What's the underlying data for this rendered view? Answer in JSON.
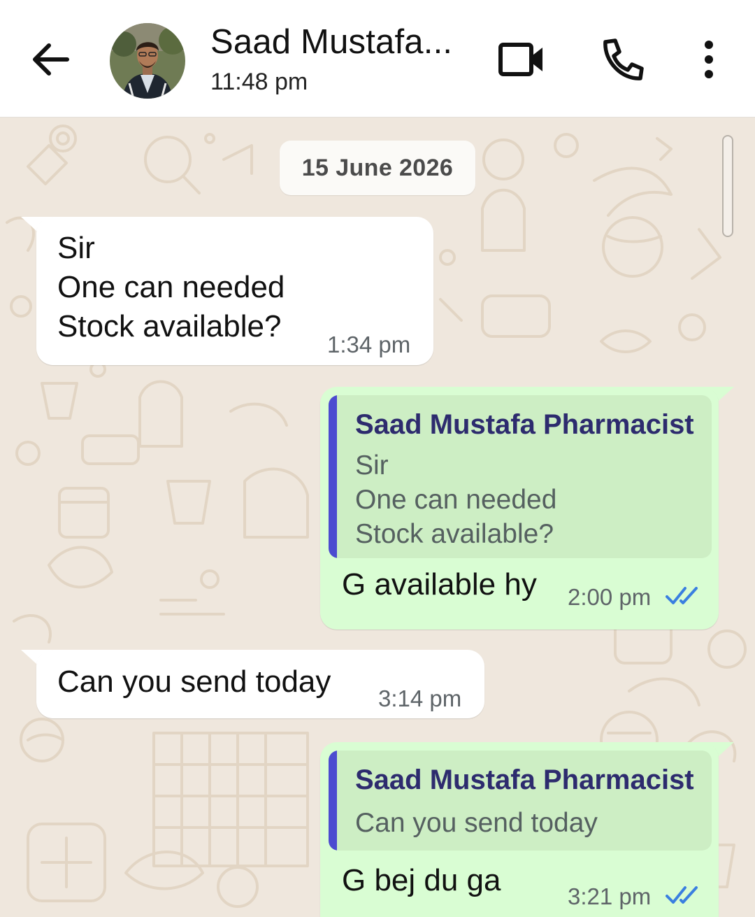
{
  "header": {
    "contact_name": "Saad Mustafa...",
    "last_seen": "11:48 pm",
    "icons": [
      "back-arrow-icon",
      "avatar",
      "video-call-icon",
      "phone-icon",
      "more-vert-icon"
    ]
  },
  "chat": {
    "date_chip": "15 June 2026",
    "messages": [
      {
        "direction": "incoming",
        "text": "Sir\nOne can needed\nStock available?",
        "time": "1:34 pm"
      },
      {
        "direction": "outgoing",
        "quote": {
          "author": "Saad Mustafa Pharmacist",
          "text": "Sir\nOne can needed\nStock available?"
        },
        "text": "G available hy",
        "time": "2:00 pm",
        "status": "read"
      },
      {
        "direction": "incoming",
        "text": "Can you send today",
        "time": "3:14 pm"
      },
      {
        "direction": "outgoing",
        "quote": {
          "author": "Saad Mustafa Pharmacist",
          "text": "Can you send today"
        },
        "text": "G bej du ga",
        "time": "3:21 pm",
        "status": "read"
      }
    ]
  },
  "colors": {
    "header_bg": "#ffffff",
    "wallpaper_bg": "#efe7dd",
    "incoming_bubble": "#ffffff",
    "outgoing_bubble": "#d9fdd3",
    "quote_bg": "#cdeec4",
    "quote_bar": "#4c4bd0",
    "read_ticks": "#3a7fe0"
  }
}
